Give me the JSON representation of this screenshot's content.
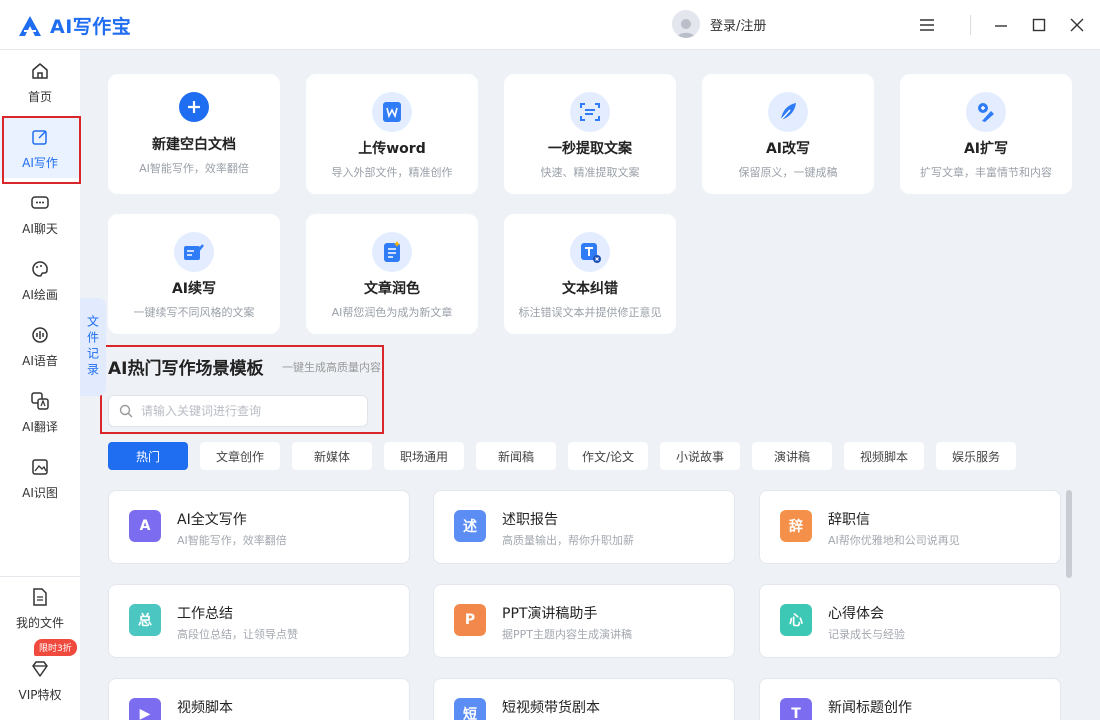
{
  "app": {
    "title": "AI写作宝",
    "login_label": "登录/注册"
  },
  "sidebar": {
    "items": [
      {
        "label": "首页",
        "icon": "home-icon"
      },
      {
        "label": "AI写作",
        "icon": "write-icon"
      },
      {
        "label": "AI聊天",
        "icon": "chat-icon"
      },
      {
        "label": "AI绘画",
        "icon": "palette-icon"
      },
      {
        "label": "AI语音",
        "icon": "voice-icon"
      },
      {
        "label": "AI翻译",
        "icon": "translate-icon"
      },
      {
        "label": "AI识图",
        "icon": "image-icon"
      }
    ],
    "my_files": "我的文件",
    "vip": "VIP特权",
    "vip_badge": "限时3折",
    "records_tab": "文件记录"
  },
  "tools": [
    {
      "title": "新建空白文档",
      "desc": "AI智能写作，效率翻倍",
      "icon": "plus-icon"
    },
    {
      "title": "上传word",
      "desc": "导入外部文件，精准创作",
      "icon": "word-icon"
    },
    {
      "title": "一秒提取文案",
      "desc": "快速、精准提取文案",
      "icon": "scan-icon"
    },
    {
      "title": "AI改写",
      "desc": "保留原义，一键成稿",
      "icon": "feather-icon"
    },
    {
      "title": "AI扩写",
      "desc": "扩写文章，丰富情节和内容",
      "icon": "expand-icon"
    },
    {
      "title": "AI续写",
      "desc": "一键续写不同风格的文案",
      "icon": "continue-icon"
    },
    {
      "title": "文章润色",
      "desc": "AI帮您润色为成为新文章",
      "icon": "polish-icon"
    },
    {
      "title": "文本纠错",
      "desc": "标注错误文本并提供修正意见",
      "icon": "correct-icon"
    }
  ],
  "section": {
    "title": "AI热门写作场景模板",
    "subtitle": "一键生成高质量内容",
    "search_placeholder": "请输入关键词进行查询"
  },
  "tags": [
    "热门",
    "文章创作",
    "新媒体",
    "职场通用",
    "新闻稿",
    "作文/论文",
    "小说故事",
    "演讲稿",
    "视频脚本",
    "娱乐服务"
  ],
  "templates": [
    {
      "title": "AI全文写作",
      "desc": "AI智能写作，效率翻倍",
      "color": "#7b6cf0",
      "glyph": "A"
    },
    {
      "title": "述职报告",
      "desc": "高质量输出，帮你升职加薪",
      "color": "#5b8df5",
      "glyph": "述"
    },
    {
      "title": "辞职信",
      "desc": "AI帮你优雅地和公司说再见",
      "color": "#f5904a",
      "glyph": "辞"
    },
    {
      "title": "工作总结",
      "desc": "高段位总结，让领导点赞",
      "color": "#4cc6c0",
      "glyph": "总"
    },
    {
      "title": "PPT演讲稿助手",
      "desc": "据PPT主题内容生成演讲稿",
      "color": "#f2884b",
      "glyph": "P"
    },
    {
      "title": "心得体会",
      "desc": "记录成长与经验",
      "color": "#3cc8b4",
      "glyph": "心"
    },
    {
      "title": "视频脚本",
      "desc": "",
      "color": "#7b6cf0",
      "glyph": "▶"
    },
    {
      "title": "短视频带货剧本",
      "desc": "",
      "color": "#5b8df5",
      "glyph": "短"
    },
    {
      "title": "新闻标题创作",
      "desc": "",
      "color": "#7b6cf0",
      "glyph": "T"
    }
  ]
}
